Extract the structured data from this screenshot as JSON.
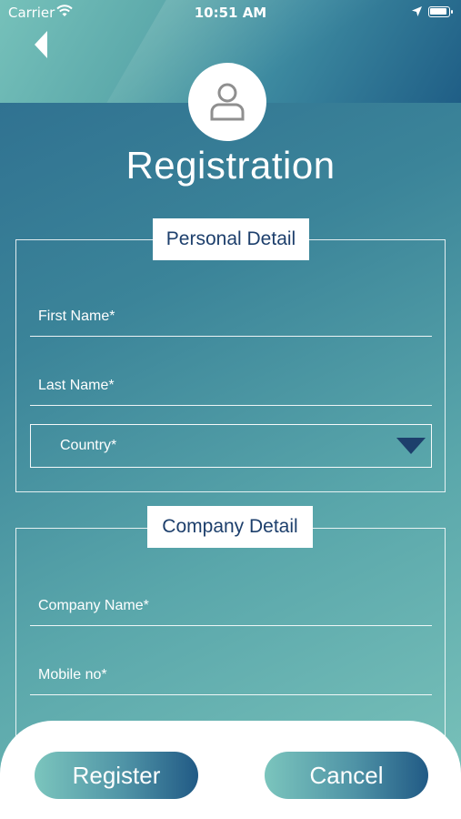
{
  "status_bar": {
    "carrier": "Carrier",
    "time": "10:51 AM",
    "icons": [
      "wifi-icon",
      "location-arrow-icon",
      "battery-icon"
    ]
  },
  "header": {
    "back_icon": "back-arrow-icon",
    "avatar_icon": "user-icon",
    "title": "Registration"
  },
  "personal": {
    "label": "Personal Detail",
    "first_name_placeholder": "First Name*",
    "last_name_placeholder": "Last Name*",
    "country_value": "Country*"
  },
  "company": {
    "label": "Company Detail",
    "company_name_placeholder": "Company Name*",
    "mobile_placeholder": "Mobile no*"
  },
  "actions": {
    "register_label": "Register",
    "cancel_label": "Cancel"
  },
  "colors": {
    "navy_text": "#1d3f6c",
    "gradient_light": "#7cc4bb",
    "gradient_dark": "#2c6b8e"
  }
}
